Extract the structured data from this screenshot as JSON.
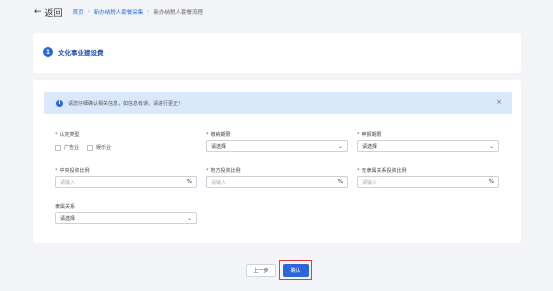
{
  "header": {
    "back_label": "返回",
    "breadcrumb": [
      "首页",
      "新办纳税人套餐采集",
      "新办纳税人套餐流程"
    ]
  },
  "section": {
    "number": "1",
    "title": "文化事业建设费"
  },
  "alert": {
    "message": "请您仔细确认相关信息，如信息有误，请进行更正！"
  },
  "form": {
    "fields": [
      {
        "label": "认定类型",
        "required": true
      },
      {
        "label": "缴纳期限",
        "required": true,
        "value": "请选择"
      },
      {
        "label": "申报期限",
        "required": true,
        "value": "请选择"
      },
      {
        "label": "中央投资比例",
        "required": true,
        "placeholder": "请输入",
        "unit": "%"
      },
      {
        "label": "地方投资比例",
        "required": true,
        "placeholder": "请输入",
        "unit": "%"
      },
      {
        "label": "无隶属关系投资比例",
        "required": true,
        "placeholder": "请输入",
        "unit": "%"
      },
      {
        "label": "隶属关系",
        "required": false,
        "value": "请选择"
      }
    ],
    "checkboxes": [
      "广告业",
      "娱乐业"
    ]
  },
  "footer": {
    "prev_label": "上一步",
    "confirm_label": "确认"
  },
  "colors": {
    "primary": "#2d66d6",
    "highlight": "#e23b3b",
    "alert_bg": "#d9e8fb"
  }
}
